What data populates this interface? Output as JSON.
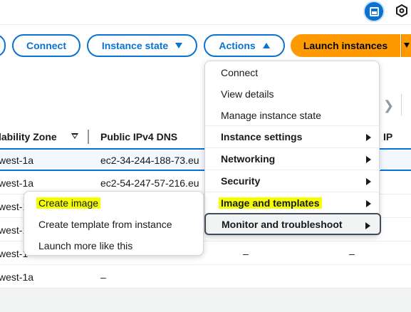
{
  "toolbar": {
    "connect_label": "Connect",
    "instance_state_label": "Instance state",
    "actions_label": "Actions",
    "launch_label": "Launch instances"
  },
  "table": {
    "headers": [
      "lability Zone",
      "Public IPv4 DNS",
      "IP"
    ],
    "rows": [
      {
        "zone": "west-1a",
        "dns": "ec2-34-244-188-73.eu",
        "ip": "",
        "selected": true
      },
      {
        "zone": "west-1a",
        "dns": "ec2-54-247-57-216.eu",
        "ip": ""
      },
      {
        "zone": "west-1",
        "dns": "",
        "ip": ""
      },
      {
        "zone": "west-1",
        "dns": "",
        "ip": ""
      },
      {
        "zone": "west-1",
        "dns": "–",
        "ip": "–",
        "dash": "–"
      },
      {
        "zone": "west-1a",
        "dns": "–",
        "ip": ""
      }
    ]
  },
  "actions_menu": {
    "items": [
      "Connect",
      "View details",
      "Manage instance state"
    ],
    "groups": [
      "Instance settings",
      "Networking",
      "Security",
      "Image and templates",
      "Monitor and troubleshoot"
    ]
  },
  "image_submenu": {
    "items": [
      "Create image",
      "Create template from instance",
      "Launch more like this"
    ]
  },
  "colors": {
    "accent": "#0972d3",
    "launch": "#ff9900",
    "highlight": "#f6ff00"
  }
}
